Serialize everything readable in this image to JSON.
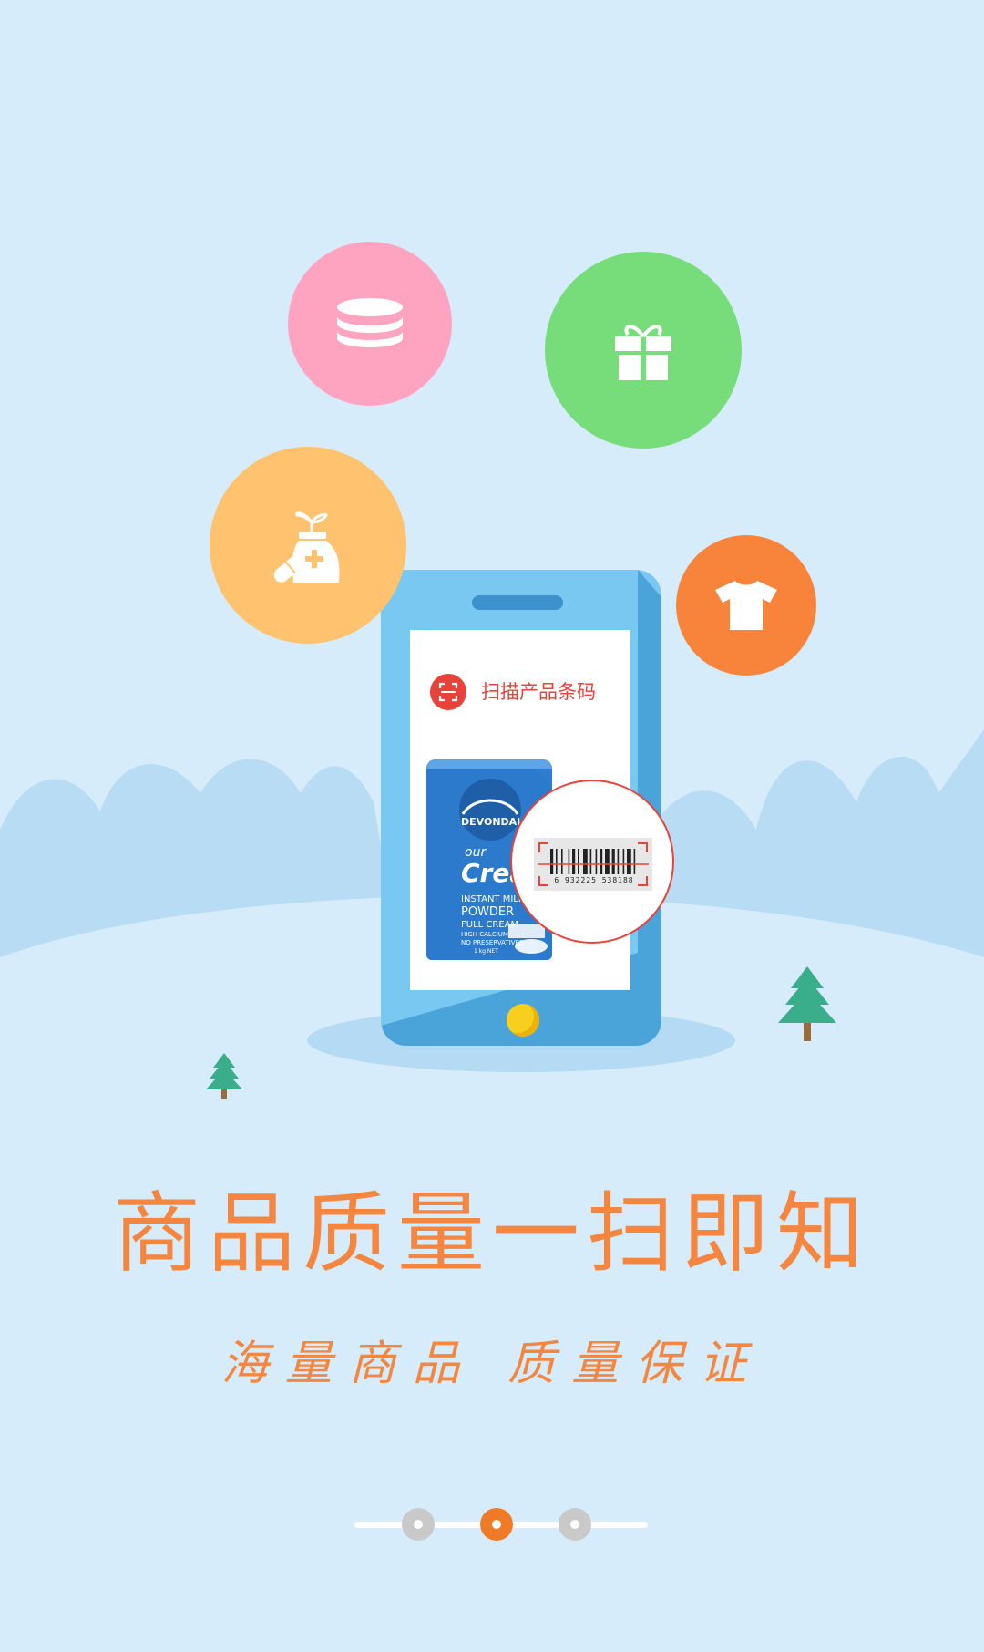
{
  "scan_card": {
    "label": "扫描产品条码"
  },
  "product": {
    "brand": "DEVONDALE",
    "name_line1": "our",
    "name_line2": "Cream",
    "desc1": "INSTANT MILK",
    "desc2": "POWDER",
    "desc3": "FULL CREAM",
    "desc4": "HIGH CALCIUM",
    "desc5": "NO PRESERVATIVES",
    "weight": "1 kg NET"
  },
  "barcode": {
    "number": "6 932225 538188"
  },
  "headline": "商品质量一扫即知",
  "tagline": "海量商品 质量保证",
  "indicator": {
    "total": 3,
    "active": 2
  },
  "colors": {
    "background": "#d6ecfb",
    "accent": "#f4863f",
    "pink": "#ffa4c0",
    "green": "#77dd7b",
    "yellow": "#ffc36f",
    "orange": "#f8843c",
    "phone": "#79c8f1"
  },
  "icons": [
    "coins-icon",
    "gift-icon",
    "medicine-icon",
    "tshirt-icon",
    "scan-icon",
    "barcode-icon",
    "tree-icon"
  ]
}
